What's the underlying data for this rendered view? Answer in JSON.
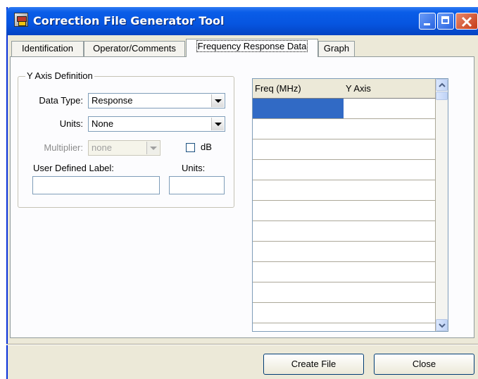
{
  "window": {
    "title": "Correction File Generator Tool"
  },
  "tabs": [
    {
      "label": "Identification"
    },
    {
      "label": "Operator/Comments"
    },
    {
      "label": "Frequency Response Data"
    },
    {
      "label": "Graph"
    }
  ],
  "active_tab": "Frequency Response Data",
  "y_axis_group": {
    "title": "Y Axis Definition",
    "data_type_label": "Data Type:",
    "data_type_value": "Response",
    "units_label": "Units:",
    "units_value": "None",
    "multiplier_label": "Multiplier:",
    "multiplier_value": "none",
    "db_label": "dB",
    "db_checked": false,
    "user_label_caption": "User Defined Label:",
    "user_units_caption": "Units:",
    "user_label_value": "",
    "user_units_value": ""
  },
  "grid": {
    "columns": [
      "Freq (MHz)",
      "Y Axis"
    ],
    "rows": [
      [
        "",
        ""
      ],
      [
        "",
        ""
      ],
      [
        "",
        ""
      ],
      [
        "",
        ""
      ],
      [
        "",
        ""
      ],
      [
        "",
        ""
      ],
      [
        "",
        ""
      ],
      [
        "",
        ""
      ],
      [
        "",
        ""
      ],
      [
        "",
        ""
      ],
      [
        "",
        ""
      ],
      [
        "",
        ""
      ]
    ]
  },
  "buttons": {
    "create_file": "Create File",
    "close": "Close"
  },
  "colors": {
    "title_bar": "#0655e0",
    "selection": "#316ac5",
    "window_bg": "#ece9d8"
  }
}
